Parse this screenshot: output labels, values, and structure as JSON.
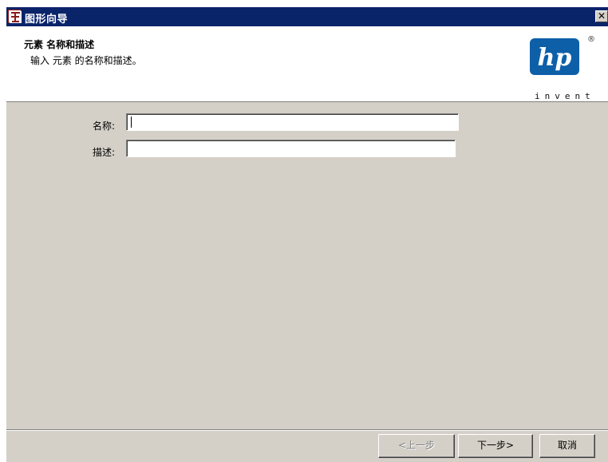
{
  "window": {
    "title": "图形向导",
    "close_glyph": "✕"
  },
  "header": {
    "title": "元素 名称和描述",
    "subtitle": "输入 元素 的名称和描述。",
    "logo": {
      "brand": "hp",
      "registered": "®",
      "tagline": "invent",
      "color": "#0d5fa8"
    }
  },
  "form": {
    "name_label": "名称:",
    "name_value": "",
    "description_label": "描述:",
    "description_value": ""
  },
  "footer": {
    "back_label": "<上一步",
    "next_label": "下一步>",
    "cancel_label": "取消"
  },
  "colors": {
    "titlebar": "#0a246a",
    "panel": "#d4d0c8"
  }
}
